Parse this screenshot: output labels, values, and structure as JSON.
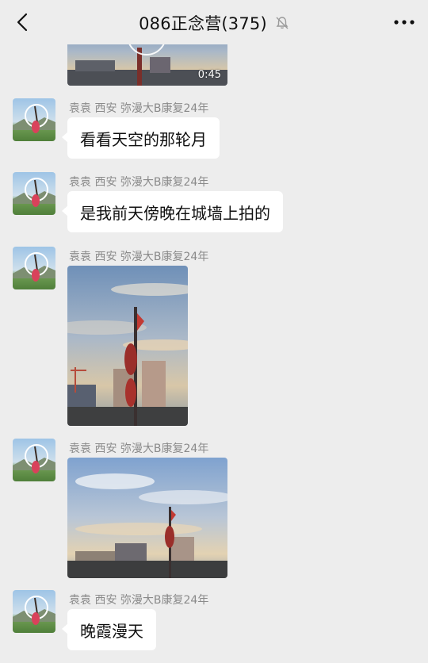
{
  "header": {
    "title": "086正念营(375)",
    "mute_icon": "bell-off-icon",
    "back_icon": "chevron-left-icon",
    "more_icon": "more-dots-icon"
  },
  "video": {
    "duration": "0:45"
  },
  "messages": [
    {
      "sender": "袁袁 西安 弥漫大B康复24年",
      "type": "text",
      "text": "看看天空的那轮月"
    },
    {
      "sender": "袁袁 西安 弥漫大B康复24年",
      "type": "text",
      "text": "是我前天傍晚在城墙上拍的"
    },
    {
      "sender": "袁袁 西安 弥漫大B康复24年",
      "type": "image"
    },
    {
      "sender": "袁袁 西安 弥漫大B康复24年",
      "type": "image"
    },
    {
      "sender": "袁袁 西安 弥漫大B康复24年",
      "type": "text",
      "text": "晚霞漫天"
    }
  ],
  "colors": {
    "background": "#ededed",
    "bubble": "#ffffff",
    "sender": "#8a8a8a"
  }
}
